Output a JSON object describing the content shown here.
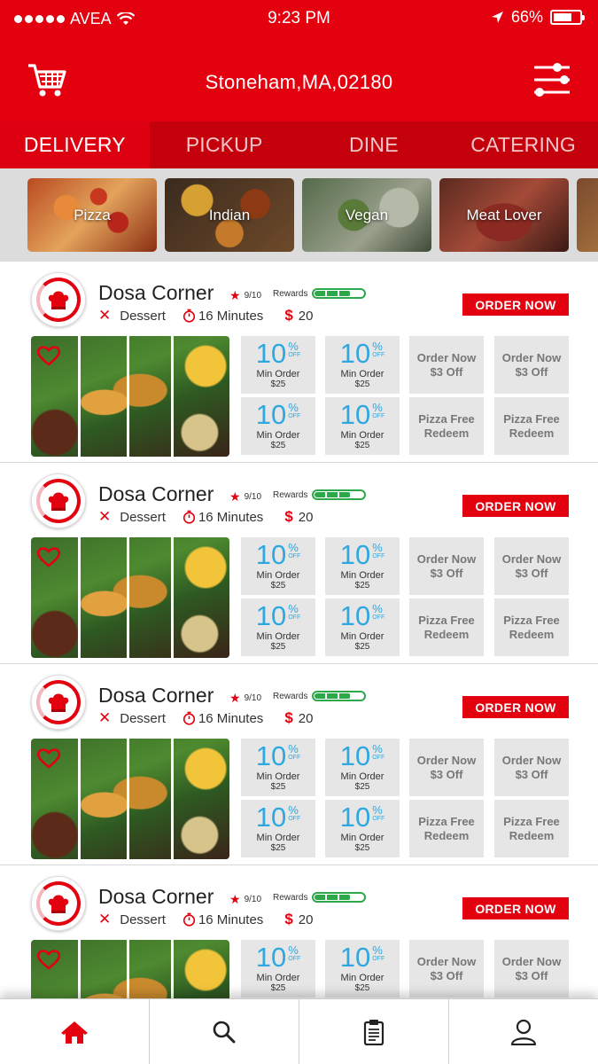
{
  "status_bar": {
    "carrier": "AVEA",
    "time": "9:23 PM",
    "battery": "66%"
  },
  "header": {
    "location": "Stoneham,MA,02180",
    "cart_icon": "cart-icon",
    "filter_icon": "filter-icon"
  },
  "tabs": [
    {
      "label": "DELIVERY",
      "active": true
    },
    {
      "label": "PICKUP",
      "active": false
    },
    {
      "label": "DINE",
      "active": false
    },
    {
      "label": "CATERING",
      "active": false
    }
  ],
  "categories": [
    "Pizza",
    "Indian",
    "Vegan",
    "Meat Lover"
  ],
  "restaurants": [
    {
      "name": "Dosa Corner",
      "rating": "9/10",
      "rewards_label": "Rewards",
      "rewards_level": 0.75,
      "category": "Dessert",
      "time": "16 Minutes",
      "currency": "$",
      "price": "20",
      "order_label": "ORDER NOW"
    },
    {
      "name": "Dosa Corner",
      "rating": "9/10",
      "rewards_label": "Rewards",
      "rewards_level": 0.75,
      "category": "Dessert",
      "time": "16 Minutes",
      "currency": "$",
      "price": "20",
      "order_label": "ORDER NOW"
    },
    {
      "name": "Dosa Corner",
      "rating": "9/10",
      "rewards_label": "Rewards",
      "rewards_level": 0.75,
      "category": "Dessert",
      "time": "16 Minutes",
      "currency": "$",
      "price": "20",
      "order_label": "ORDER NOW"
    },
    {
      "name": "Dosa Corner",
      "rating": "9/10",
      "rewards_label": "Rewards",
      "rewards_level": 0.75,
      "category": "Dessert",
      "time": "16 Minutes",
      "currency": "$",
      "price": "20",
      "order_label": "ORDER NOW"
    }
  ],
  "offer": {
    "percent": "10",
    "percent_sign": "%",
    "off_word": "OFF",
    "min_order_label": "Min Order",
    "min_order_amount": "$25",
    "order_now_line1": "Order Now",
    "order_now_line2": "$3 Off",
    "pizza_line1": "Pizza Free",
    "pizza_line2": "Redeem"
  },
  "bottom_nav": [
    "home-icon",
    "search-icon",
    "orders-icon",
    "profile-icon"
  ],
  "colors": {
    "brand_red": "#e3000f",
    "tab_bar": "#c3000c",
    "offer_blue": "#2fa8e0",
    "rewards_green": "#2ca84a"
  }
}
